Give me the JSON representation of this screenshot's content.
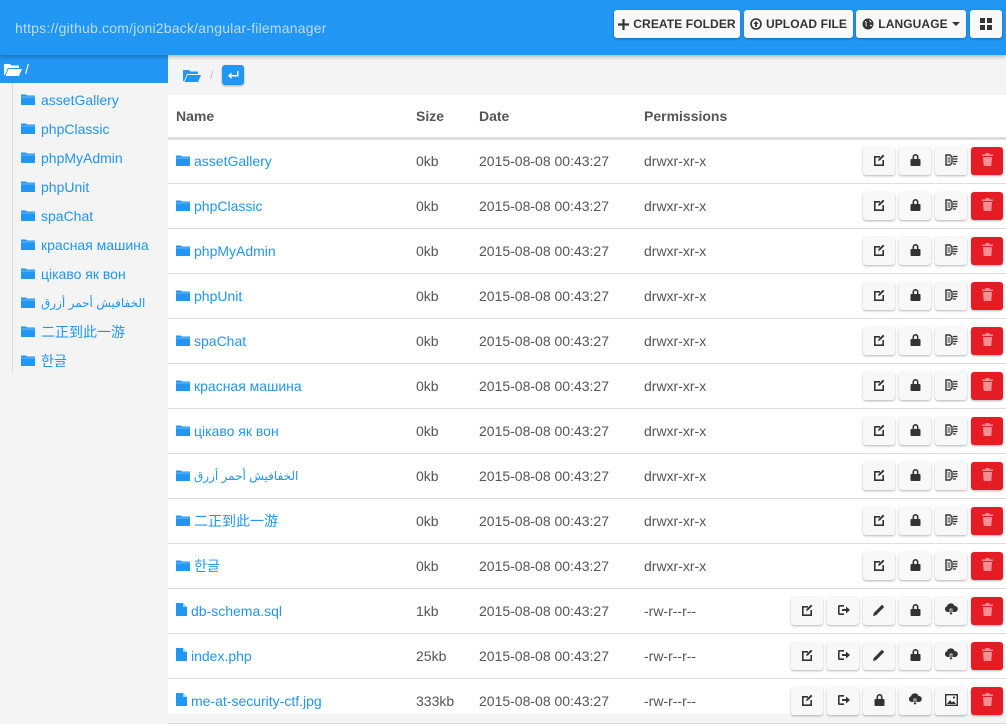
{
  "topbar": {
    "url": "https://github.com/joni2back/angular-filemanager",
    "buttons": {
      "create_folder": "CREATE FOLDER",
      "upload_file": "UPLOAD FILE",
      "language": "LANGUAGE"
    }
  },
  "sidebar": {
    "root_label": "/",
    "items": [
      {
        "label": "assetGallery"
      },
      {
        "label": "phpClassic"
      },
      {
        "label": "phpMyAdmin"
      },
      {
        "label": "phpUnit"
      },
      {
        "label": "spaChat"
      },
      {
        "label": "красная машина"
      },
      {
        "label": "цікаво як вон"
      },
      {
        "label": "الخفافيش أحمر أزرق"
      },
      {
        "label": "二正到此一游"
      },
      {
        "label": "한글"
      }
    ]
  },
  "breadcrumb": {
    "separator": "/"
  },
  "table": {
    "headers": {
      "name": "Name",
      "size": "Size",
      "date": "Date",
      "permissions": "Permissions"
    },
    "rows": [
      {
        "type": "folder",
        "name": "assetGallery",
        "size": "0kb",
        "date": "2015-08-08 00:43:27",
        "perm": "drwxr-xr-x"
      },
      {
        "type": "folder",
        "name": "phpClassic",
        "size": "0kb",
        "date": "2015-08-08 00:43:27",
        "perm": "drwxr-xr-x"
      },
      {
        "type": "folder",
        "name": "phpMyAdmin",
        "size": "0kb",
        "date": "2015-08-08 00:43:27",
        "perm": "drwxr-xr-x"
      },
      {
        "type": "folder",
        "name": "phpUnit",
        "size": "0kb",
        "date": "2015-08-08 00:43:27",
        "perm": "drwxr-xr-x"
      },
      {
        "type": "folder",
        "name": "spaChat",
        "size": "0kb",
        "date": "2015-08-08 00:43:27",
        "perm": "drwxr-xr-x"
      },
      {
        "type": "folder",
        "name": "красная машина",
        "size": "0kb",
        "date": "2015-08-08 00:43:27",
        "perm": "drwxr-xr-x"
      },
      {
        "type": "folder",
        "name": "цікаво як вон",
        "size": "0kb",
        "date": "2015-08-08 00:43:27",
        "perm": "drwxr-xr-x"
      },
      {
        "type": "folder",
        "name": "الخفافيش أحمر أزرق",
        "size": "0kb",
        "date": "2015-08-08 00:43:27",
        "perm": "drwxr-xr-x"
      },
      {
        "type": "folder",
        "name": "二正到此一游",
        "size": "0kb",
        "date": "2015-08-08 00:43:27",
        "perm": "drwxr-xr-x"
      },
      {
        "type": "folder",
        "name": "한글",
        "size": "0kb",
        "date": "2015-08-08 00:43:27",
        "perm": "drwxr-xr-x"
      },
      {
        "type": "file",
        "name": "db-schema.sql",
        "size": "1kb",
        "date": "2015-08-08 00:43:27",
        "perm": "-rw-r--r--"
      },
      {
        "type": "file",
        "name": "index.php",
        "size": "25kb",
        "date": "2015-08-08 00:43:27",
        "perm": "-rw-r--r--"
      },
      {
        "type": "file",
        "name": "me-at-security-ctf.jpg",
        "size": "333kb",
        "date": "2015-08-08 00:43:27",
        "perm": "-rw-r--r--"
      }
    ],
    "actions": {
      "folder": [
        "rename",
        "permissions",
        "compress",
        "delete"
      ],
      "text-file": [
        "rename",
        "move",
        "edit",
        "permissions",
        "download",
        "delete"
      ],
      "image-file": [
        "rename",
        "move",
        "permissions",
        "download",
        "preview",
        "delete"
      ]
    }
  },
  "colors": {
    "accent": "#2196f3",
    "danger": "#e51c23",
    "link": "#2196f3"
  }
}
